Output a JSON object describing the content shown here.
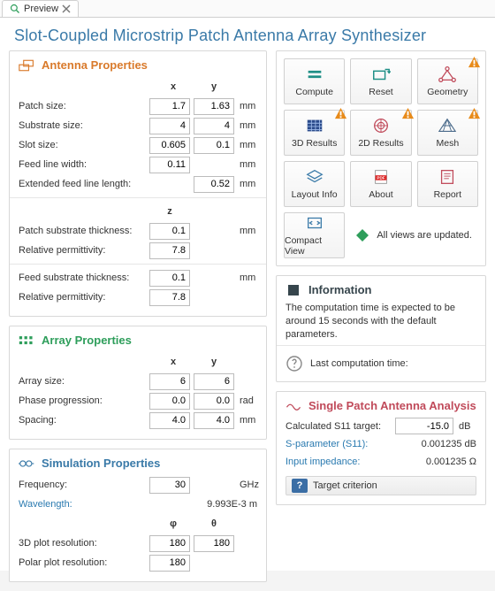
{
  "tab": {
    "label": "Preview"
  },
  "title": "Slot-Coupled Microstrip Patch Antenna Array Synthesizer",
  "antenna": {
    "heading": "Antenna Properties",
    "cols": {
      "x": "x",
      "y": "y",
      "z": "z"
    },
    "patch": {
      "label": "Patch size:",
      "x": "1.7",
      "y": "1.63",
      "unit": "mm"
    },
    "substr": {
      "label": "Substrate size:",
      "x": "4",
      "y": "4",
      "unit": "mm"
    },
    "slot": {
      "label": "Slot size:",
      "x": "0.605",
      "y": "0.1",
      "unit": "mm"
    },
    "feedw": {
      "label": "Feed line width:",
      "v": "0.11",
      "unit": "mm"
    },
    "extfeed": {
      "label": "Extended feed line length:",
      "v": "0.52",
      "unit": "mm"
    },
    "psub": {
      "label": "Patch substrate thickness:",
      "z": "0.1",
      "unit": "mm"
    },
    "perm1": {
      "label": "Relative permittivity:",
      "z": "7.8"
    },
    "fsub": {
      "label": "Feed substrate thickness:",
      "z": "0.1",
      "unit": "mm"
    },
    "perm2": {
      "label": "Relative permittivity:",
      "z": "7.8"
    }
  },
  "array": {
    "heading": "Array Properties",
    "cols": {
      "x": "x",
      "y": "y"
    },
    "size": {
      "label": "Array size:",
      "x": "6",
      "y": "6"
    },
    "phase": {
      "label": "Phase progression:",
      "x": "0.0",
      "y": "0.0",
      "unit": "rad"
    },
    "space": {
      "label": "Spacing:",
      "x": "4.0",
      "y": "4.0",
      "unit": "mm"
    }
  },
  "sim": {
    "heading": "Simulation Properties",
    "freq": {
      "label": "Frequency:",
      "v": "30",
      "unit": "GHz"
    },
    "wave": {
      "label": "Wavelength:",
      "v": "9.993E-3 m"
    },
    "cols": {
      "phi": "φ",
      "theta": "θ"
    },
    "plot3d": {
      "label": "3D plot resolution:",
      "phi": "180",
      "theta": "180"
    },
    "polar": {
      "label": "Polar plot resolution:",
      "v": "180"
    }
  },
  "buttons": {
    "compute": "Compute",
    "reset": "Reset",
    "geometry": "Geometry",
    "r3d": "3D Results",
    "r2d": "2D Results",
    "mesh": "Mesh",
    "layout": "Layout Info",
    "about": "About",
    "report": "Report",
    "compact": "Compact View",
    "status": "All views are updated."
  },
  "info": {
    "heading": "Information",
    "text": "The computation time is expected to be around 15 seconds with the default parameters.",
    "last": "Last computation time:"
  },
  "analysis": {
    "heading": "Single Patch Antenna Analysis",
    "s11t": {
      "label": "Calculated S11 target:",
      "v": "-15.0",
      "unit": "dB"
    },
    "sparam": {
      "label": "S-parameter (S11):",
      "v": "0.001235 dB"
    },
    "zin": {
      "label": "Input impedance:",
      "v": "0.001235 Ω"
    },
    "footer": {
      "label": "Target criterion"
    }
  }
}
